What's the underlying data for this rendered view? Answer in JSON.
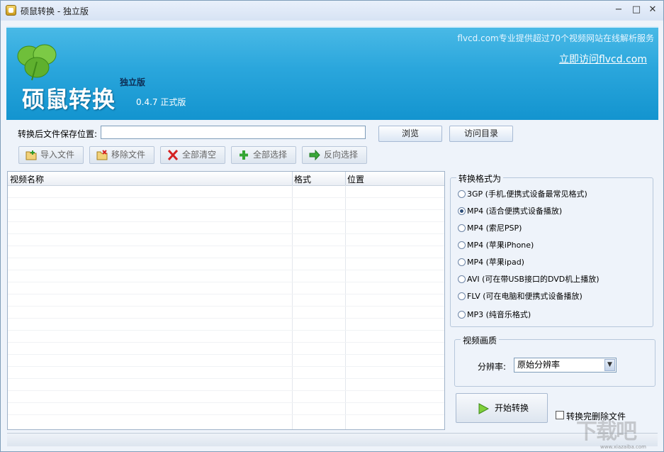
{
  "window": {
    "title": "硕鼠转换 - 独立版",
    "minimize": "−",
    "maximize": "□",
    "close": "✕"
  },
  "banner": {
    "brand": "硕鼠转换",
    "edition": "独立版",
    "version": "0.4.7  正式版",
    "slogan": "flvcd.com专业提供超过70个视频网站在线解析服务",
    "visit_link": "立即访问flvcd.com"
  },
  "save": {
    "label": "转换后文件保存位置:",
    "value": "",
    "browse": "浏览",
    "open_dir": "访问目录"
  },
  "toolbar": {
    "import": "导入文件",
    "remove": "移除文件",
    "clear": "全部清空",
    "select_all": "全部选择",
    "invert": "反向选择"
  },
  "list": {
    "columns": [
      "视频名称",
      "格式",
      "位置"
    ],
    "rows": []
  },
  "format": {
    "title": "转换格式为",
    "selected": 1,
    "options": [
      "3GP (手机,便携式设备最常见格式)",
      "MP4 (适合便携式设备播放)",
      "MP4 (索尼PSP)",
      "MP4 (苹果iPhone)",
      "MP4 (苹果ipad)",
      "AVI  (可在带USB接口的DVD机上播放)",
      "FLV  (可在电脑和便携式设备播放)",
      "MP3 (纯音乐格式)"
    ]
  },
  "quality": {
    "title": "视频画质",
    "resolution_label": "分辨率:",
    "resolution_value": "原始分辨率"
  },
  "actions": {
    "start": "开始转换",
    "delete_after_label": "转换完删除文件",
    "delete_after_checked": false
  },
  "watermark": {
    "text": "下载吧",
    "sub": "www.xiazaiba.com"
  },
  "colors": {
    "banner": "#2aa6dc",
    "accent": "#1394cf"
  }
}
